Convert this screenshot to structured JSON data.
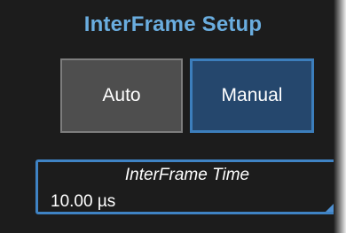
{
  "panel": {
    "title": "InterFrame Setup"
  },
  "mode_buttons": {
    "auto_label": "Auto",
    "manual_label": "Manual",
    "selected": "Manual"
  },
  "interframe_time": {
    "label": "InterFrame Time",
    "value": "10.00 µs"
  },
  "colors": {
    "title_accent": "#6aaddf",
    "selected_button_fill": "#25476d",
    "selected_border": "#3c7ebc",
    "unselected_button_fill": "#4e4e4e",
    "panel_background": "#1c1c1c"
  }
}
